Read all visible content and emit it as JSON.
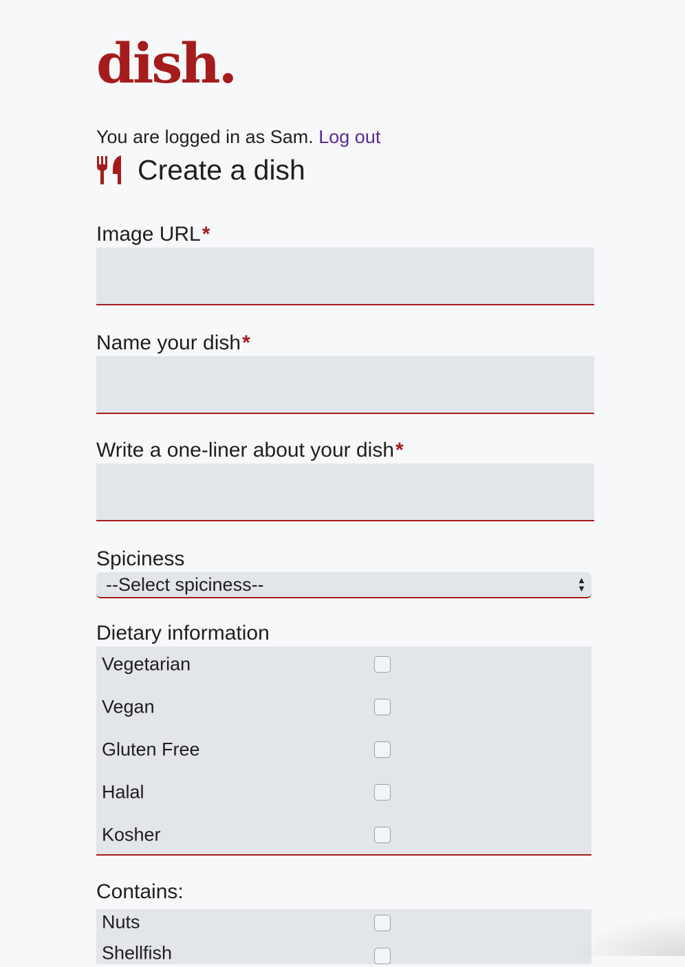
{
  "brand": {
    "logo_text": "dish."
  },
  "session": {
    "logged_in_text": "You are logged in as Sam.",
    "logout_label": "Log out"
  },
  "page": {
    "title": "Create a dish",
    "title_icon": "utensils-icon"
  },
  "form": {
    "required_marker": "*",
    "image_url": {
      "label": "Image URL",
      "value": ""
    },
    "dish_name": {
      "label": "Name your dish",
      "value": ""
    },
    "one_liner": {
      "label": "Write a one-liner about your dish",
      "value": ""
    },
    "spiciness": {
      "label": "Spiciness",
      "selected": "--Select spiciness--"
    },
    "dietary": {
      "label": "Dietary information",
      "options": [
        {
          "label": "Vegetarian",
          "checked": false
        },
        {
          "label": "Vegan",
          "checked": false
        },
        {
          "label": "Gluten Free",
          "checked": false
        },
        {
          "label": "Halal",
          "checked": false
        },
        {
          "label": "Kosher",
          "checked": false
        }
      ]
    },
    "contains": {
      "label": "Contains:",
      "options": [
        {
          "label": "Nuts",
          "checked": false
        },
        {
          "label": "Shellfish",
          "checked": false
        }
      ]
    }
  },
  "colors": {
    "brand_red": "#a51c1c",
    "link_purple": "#5b2a91",
    "input_bg": "#e2e5e9",
    "page_bg": "#f7f8fa"
  }
}
